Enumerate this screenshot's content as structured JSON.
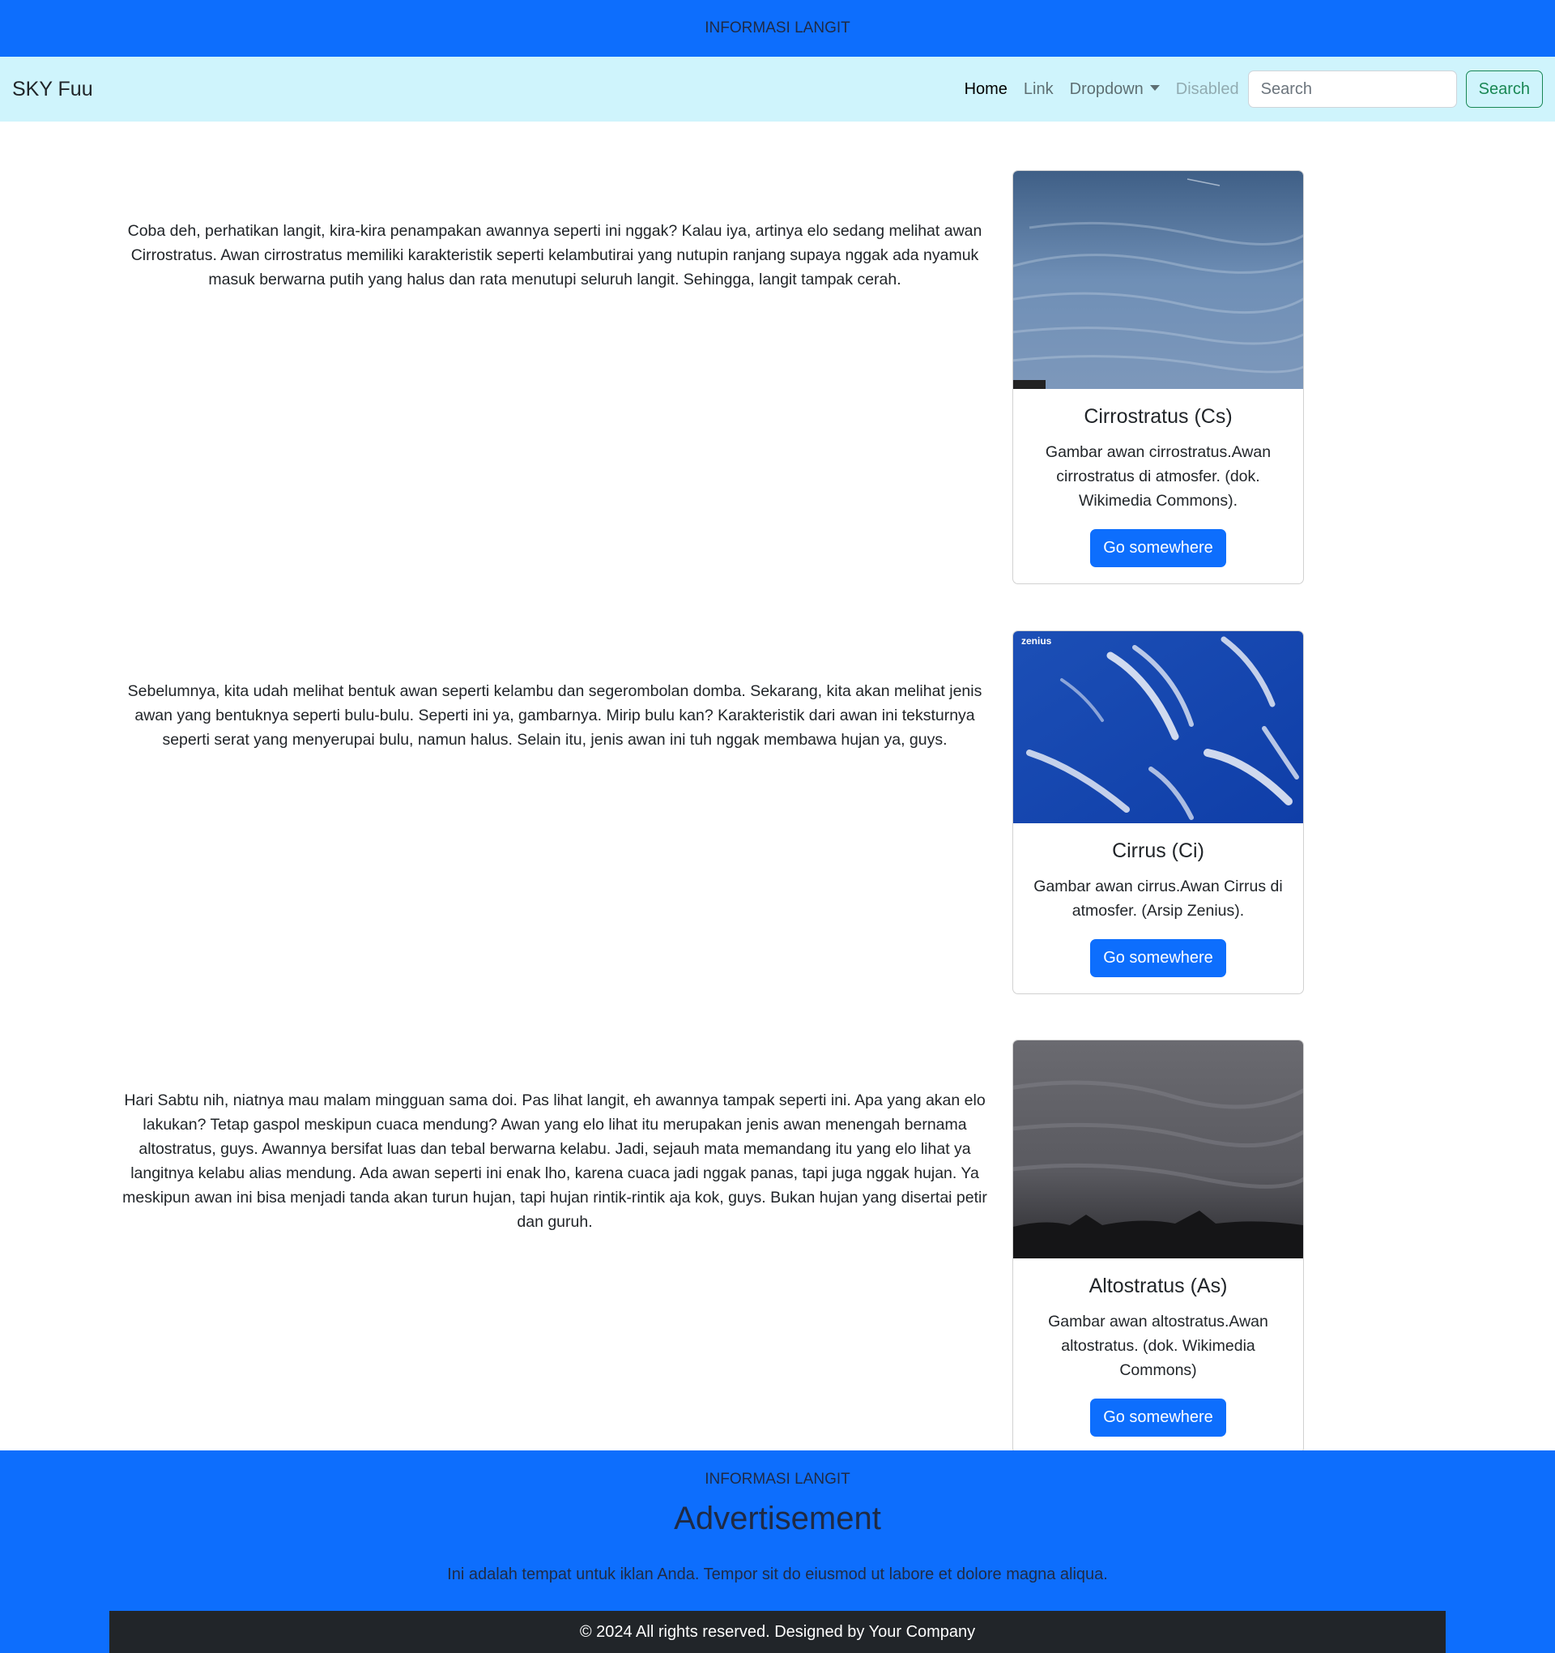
{
  "topbar": {
    "title": "INFORMASI LANGIT"
  },
  "navbar": {
    "brand": "SKY Fuu",
    "links": {
      "home": "Home",
      "link": "Link",
      "dropdown": "Dropdown",
      "disabled": "Disabled"
    },
    "search": {
      "placeholder": "Search",
      "button": "Search"
    }
  },
  "sections": [
    {
      "text": "Coba deh, perhatikan langit, kira-kira penampakan awannya seperti ini nggak? Kalau iya, artinya elo sedang melihat awan Cirrostratus. Awan cirrostratus memiliki karakteristik seperti kelambutirai yang nutupin ranjang supaya nggak ada nyamuk masuk berwarna putih yang halus dan rata menutupi seluruh langit. Sehingga, langit tampak cerah.",
      "card": {
        "title": "Cirrostratus (Cs)",
        "text": "Gambar awan cirrostratus.Awan cirrostratus di atmosfer. (dok. Wikimedia Commons).",
        "button": "Go somewhere"
      }
    },
    {
      "text": "Sebelumnya, kita udah melihat bentuk awan seperti kelambu dan segerombolan domba. Sekarang, kita akan melihat jenis awan yang bentuknya seperti bulu-bulu. Seperti ini ya, gambarnya. Mirip bulu kan? Karakteristik dari awan ini teksturnya seperti serat yang menyerupai bulu, namun halus. Selain itu, jenis awan ini tuh nggak membawa hujan ya, guys.",
      "card": {
        "title": "Cirrus (Ci)",
        "text": "Gambar awan cirrus.Awan Cirrus di atmosfer. (Arsip Zenius).",
        "button": "Go somewhere",
        "watermark": "zenius"
      }
    },
    {
      "text": "Hari Sabtu nih, niatnya mau malam mingguan sama doi. Pas lihat langit, eh awannya tampak seperti ini. Apa yang akan elo lakukan? Tetap gaspol meskipun cuaca mendung? Awan yang elo lihat itu merupakan jenis awan menengah bernama altostratus, guys. Awannya bersifat luas dan tebal berwarna kelabu. Jadi, sejauh mata memandang itu yang elo lihat ya langitnya kelabu alias mendung. Ada awan seperti ini enak lho, karena cuaca jadi nggak panas, tapi juga nggak hujan. Ya meskipun awan ini bisa menjadi tanda akan turun hujan, tapi hujan rintik-rintik aja kok, guys. Bukan hujan yang disertai petir dan guruh.",
      "card": {
        "title": "Altostratus (As)",
        "text": "Gambar awan altostratus.Awan altostratus. (dok. Wikimedia Commons)",
        "button": "Go somewhere"
      }
    }
  ],
  "footer": {
    "brand": "INFORMASI LANGIT",
    "title": "Advertisement",
    "text": "Ini adalah tempat untuk iklan Anda. Tempor sit do eiusmod ut labore et dolore magna aliqua.",
    "copyright": "© 2024 All rights reserved. Designed by Your Company"
  },
  "colors": {
    "primary": "#0d6efd",
    "navbar_bg": "#cff4fc",
    "success": "#198754",
    "dark": "#212529"
  }
}
